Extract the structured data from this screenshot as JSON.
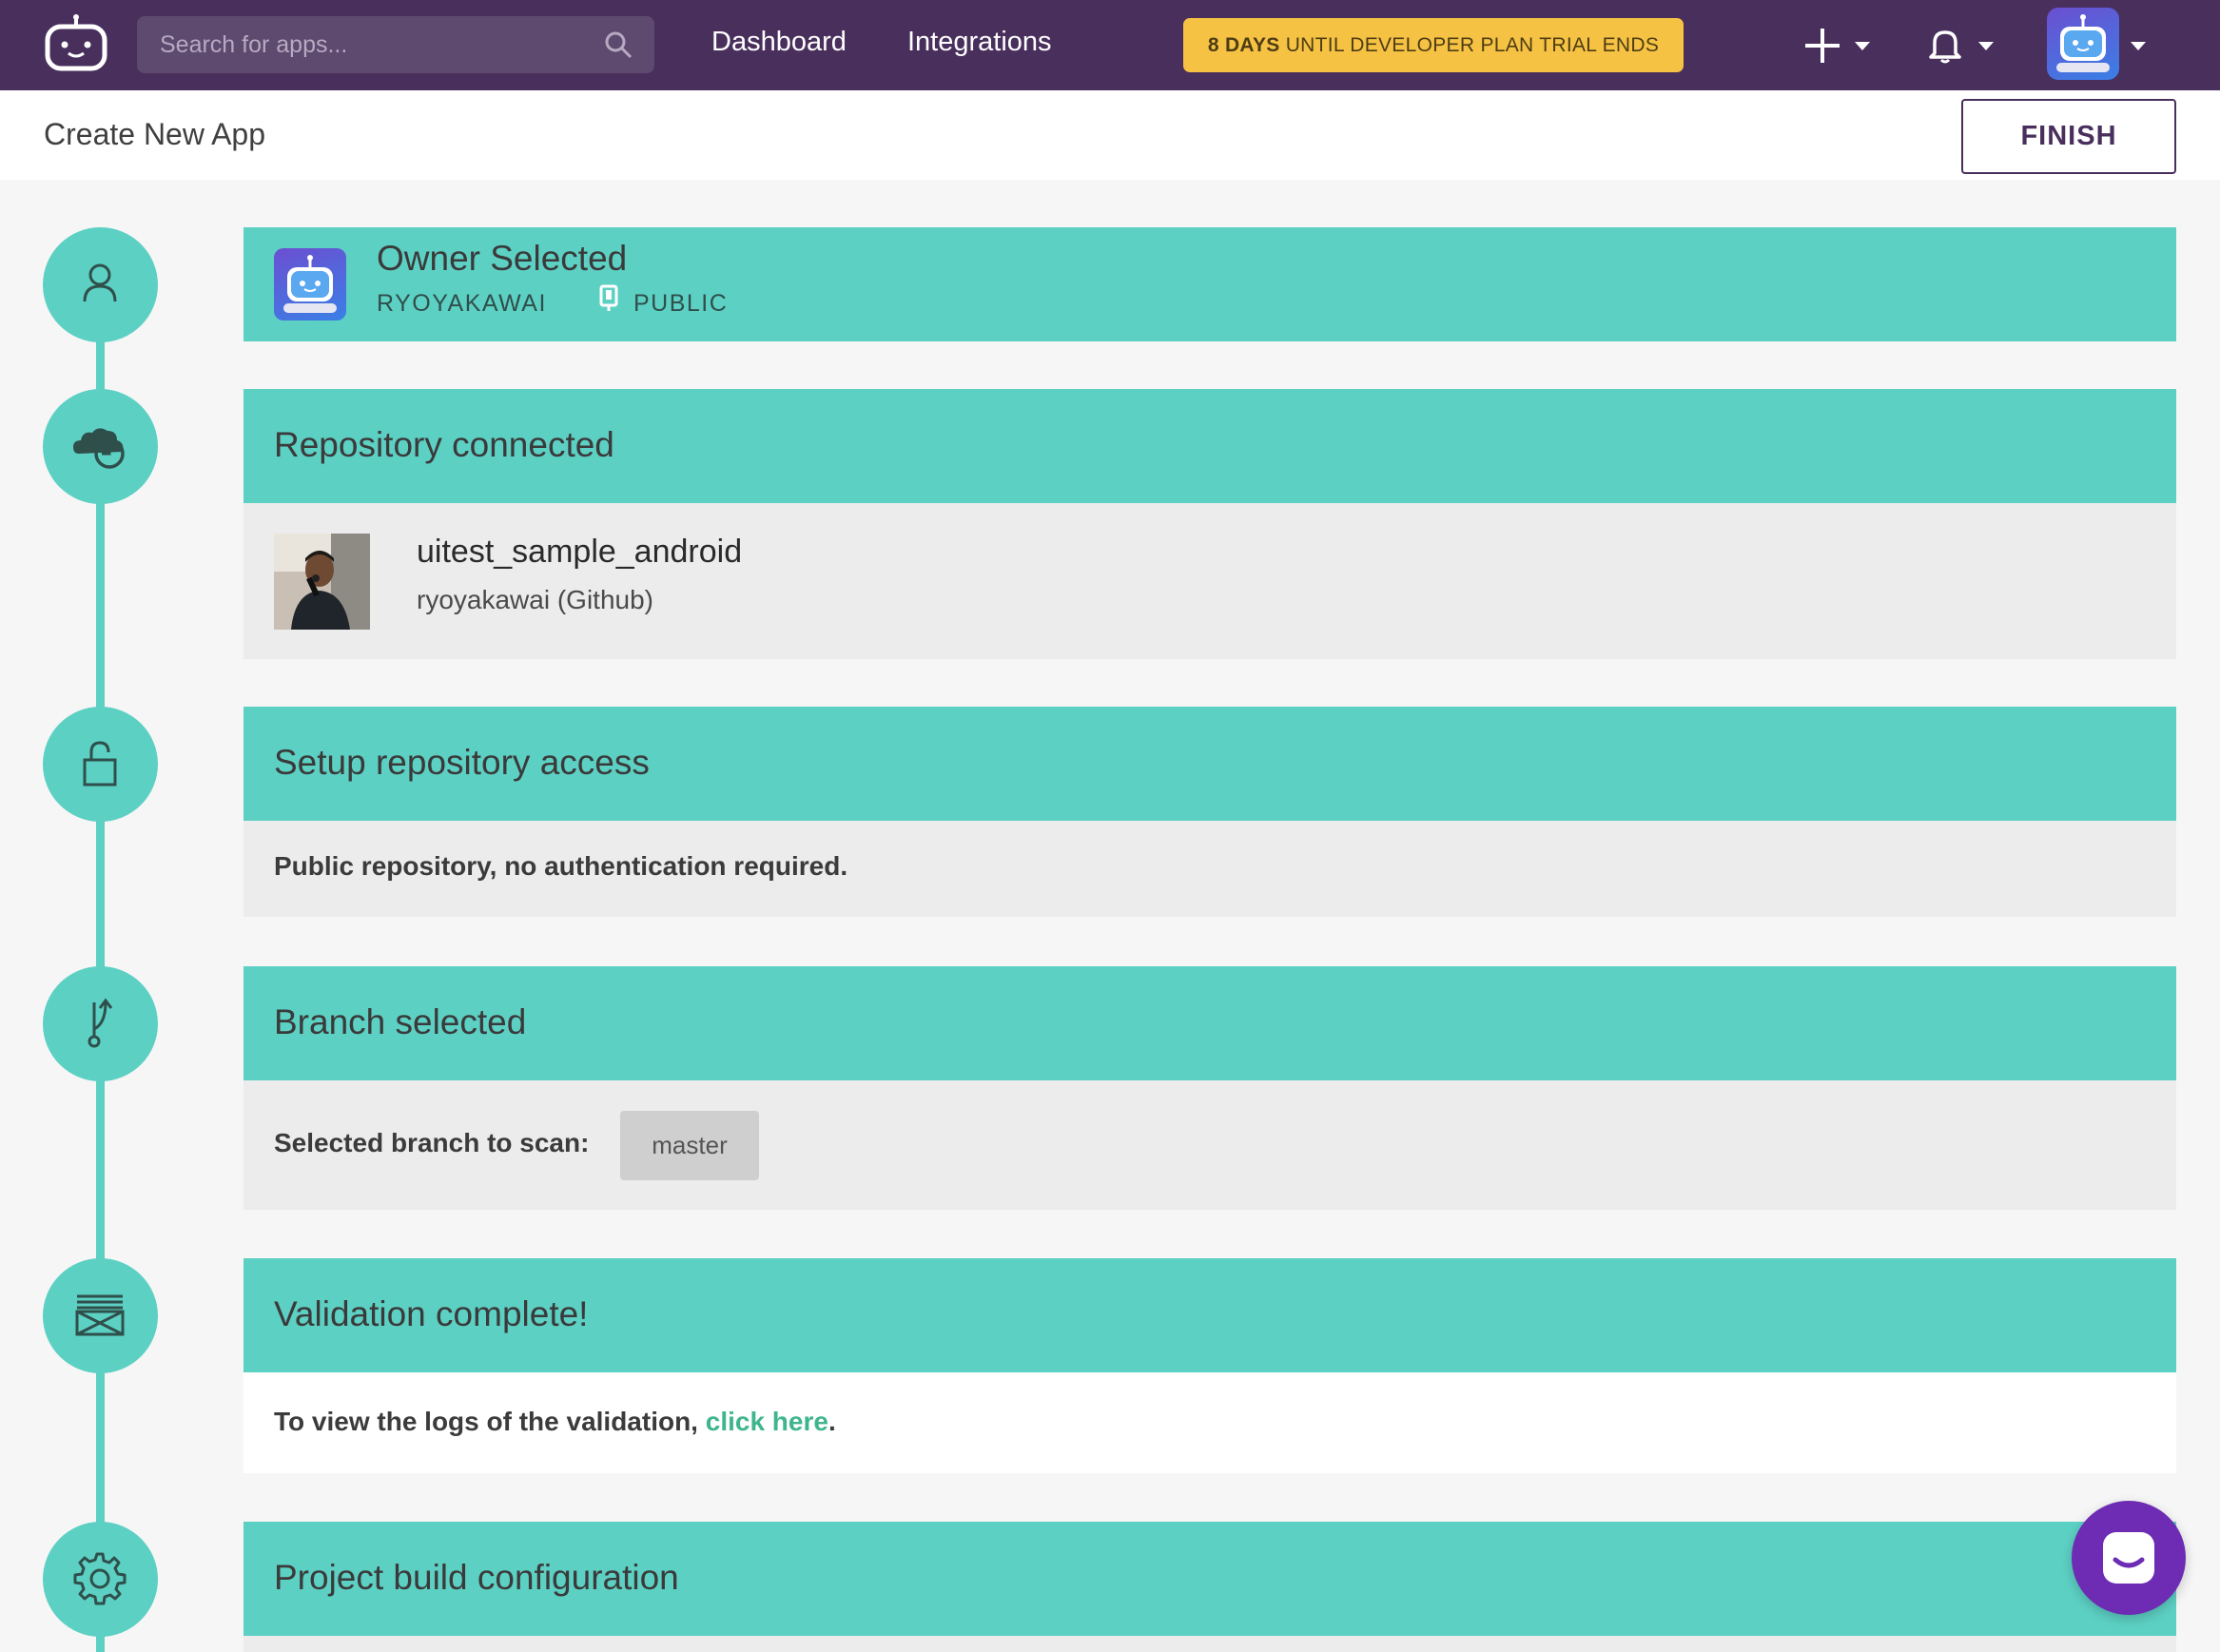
{
  "nav": {
    "search_placeholder": "Search for apps...",
    "links": [
      "Dashboard",
      "Integrations"
    ],
    "trial_days": "8 DAYS",
    "trial_text": " UNTIL DEVELOPER PLAN TRIAL ENDS"
  },
  "subheader": {
    "title": "Create New App",
    "finish_label": "FINISH"
  },
  "steps": {
    "owner": {
      "title": "Owner Selected",
      "username": "RYOYAKAWAI",
      "visibility": "PUBLIC"
    },
    "repository": {
      "title": "Repository connected",
      "repo_name": "uitest_sample_android",
      "repo_source": "ryoyakawai (Github)"
    },
    "access": {
      "title": "Setup repository access",
      "message": "Public repository, no authentication required."
    },
    "branch": {
      "title": "Branch selected",
      "label": "Selected branch to scan:",
      "branch_name": "master"
    },
    "validation": {
      "title": "Validation complete!",
      "message_prefix": "To view the logs of the validation, ",
      "link_text": "click here",
      "message_suffix": "."
    },
    "build": {
      "title": "Project build configuration"
    }
  },
  "icons": {
    "logo": "bitrise-robot-logo",
    "search": "search-icon",
    "add": "plus-icon",
    "notifications": "bell-icon",
    "user": "robot-avatar",
    "chat": "chat-icon"
  },
  "colors": {
    "nav_bg": "#492f5c",
    "teal": "#5dd0c4",
    "trial_banner": "#f6c244",
    "link": "#3fb58e",
    "chat": "#6d2cb3"
  }
}
